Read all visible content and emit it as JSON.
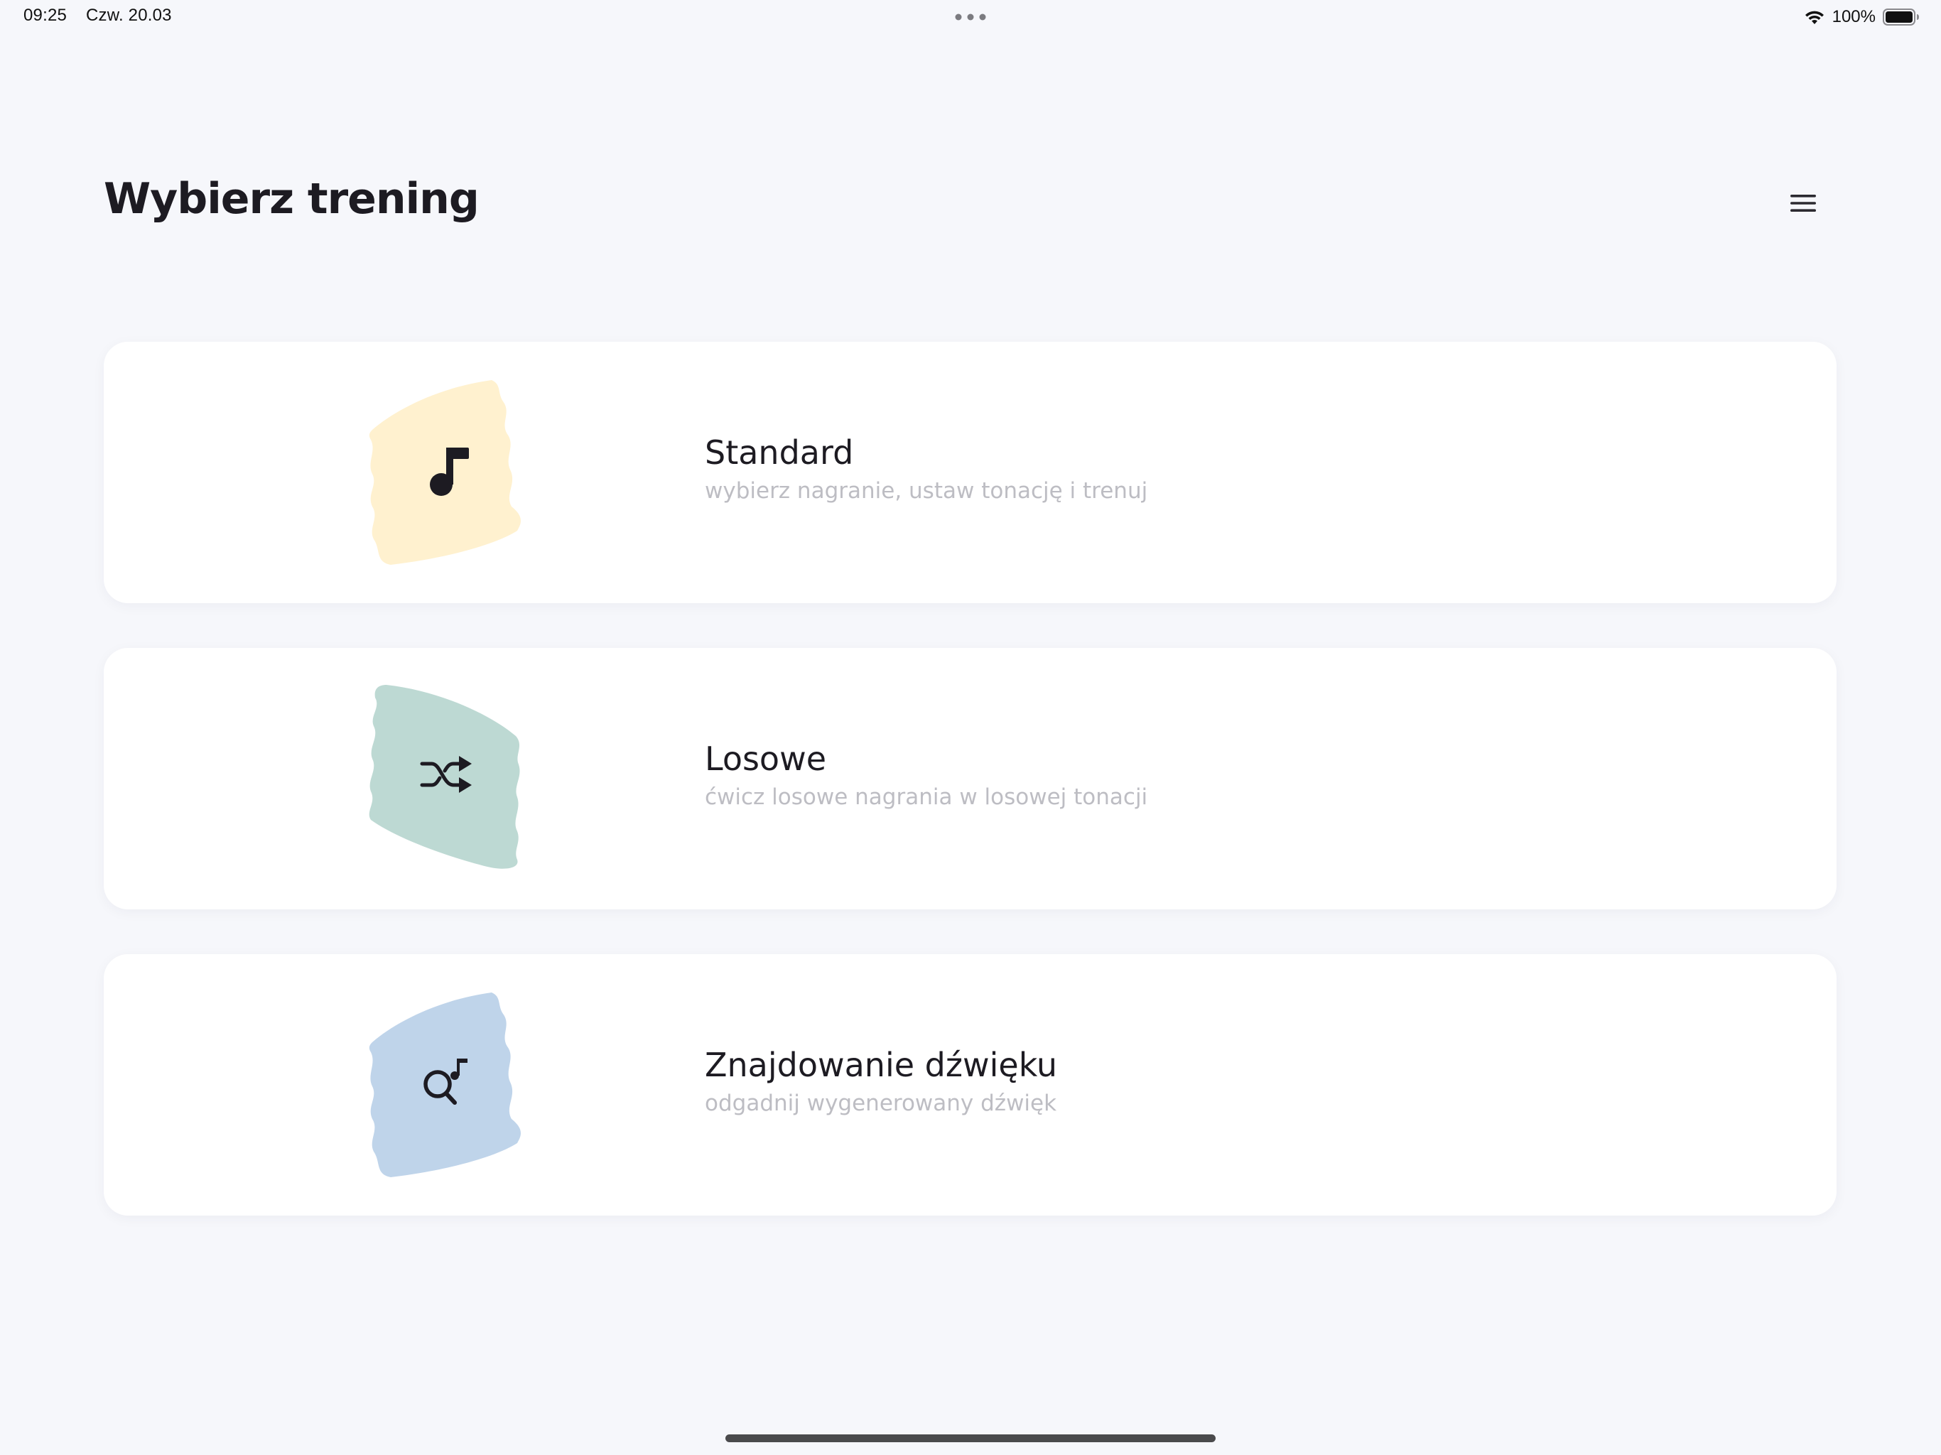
{
  "status_bar": {
    "time": "09:25",
    "date": "Czw. 20.03",
    "battery_percent": "100%",
    "icons": [
      "wifi-icon",
      "battery-icon"
    ]
  },
  "header": {
    "title": "Wybierz trening",
    "menu_icon": "hamburger-menu-icon"
  },
  "trainings": [
    {
      "title": "Standard",
      "subtitle": "wybierz nagranie, ustaw tonację i trenuj",
      "icon": "music-note-icon",
      "blob_color": "#fff1cf"
    },
    {
      "title": "Losowe",
      "subtitle": "ćwicz losowe nagrania w losowej tonacji",
      "icon": "shuffle-icon",
      "blob_color": "#bdd9d3"
    },
    {
      "title": "Znajdowanie dźwięku",
      "subtitle": "odgadnij wygenerowany dźwięk",
      "icon": "search-note-icon",
      "blob_color": "#bfd4ea"
    }
  ],
  "colors": {
    "background": "#f6f7fb",
    "card": "#ffffff",
    "title_text": "#1d1b22",
    "subtitle_text": "#bdbdc3"
  }
}
